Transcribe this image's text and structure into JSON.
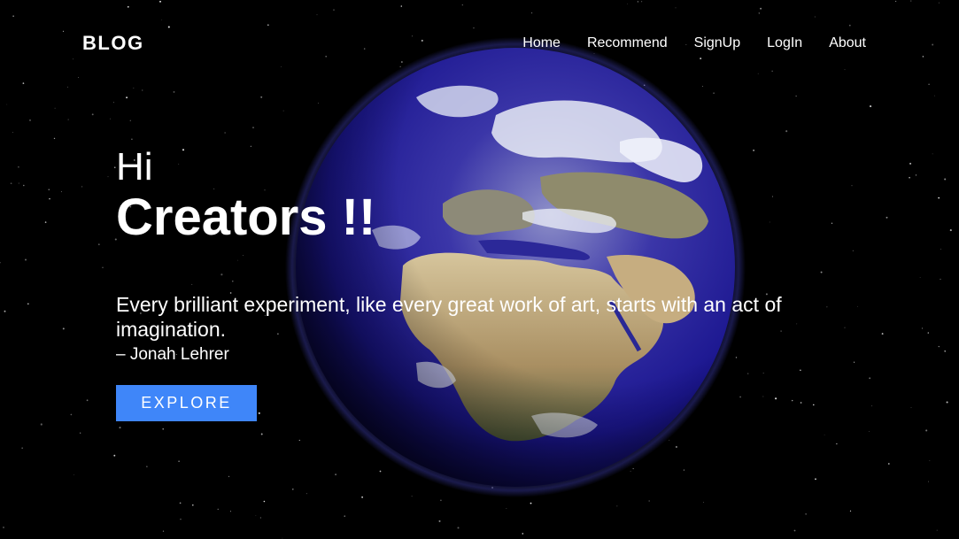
{
  "header": {
    "logo": "BLOG",
    "nav": [
      "Home",
      "Recommend",
      "SignUp",
      "LogIn",
      "About"
    ]
  },
  "hero": {
    "greeting": "Hi",
    "title": "Creators !!",
    "quote": "Every brilliant experiment, like every great work of art, starts with an act of imagination.",
    "author": "– Jonah Lehrer",
    "cta": "EXPLORE"
  },
  "colors": {
    "background": "#000000",
    "text": "#ffffff",
    "button": "#3f86f9",
    "earth_ocean": "#1d1a8a",
    "earth_land": "#c9b48a"
  },
  "background_image": "earth-from-space"
}
